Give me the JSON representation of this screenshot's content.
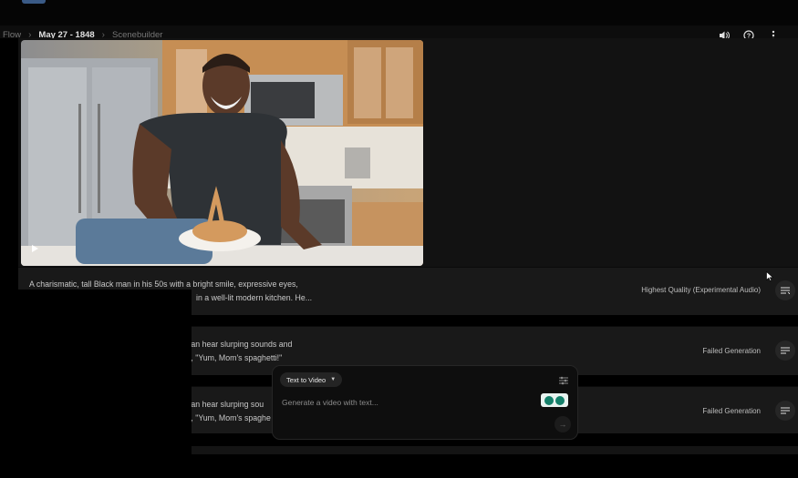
{
  "header": {
    "breadcrumb": [
      "Flow",
      "May 27 - 1848",
      "Scenebuilder"
    ],
    "icons": [
      "volume-icon",
      "help-icon",
      "more-vert-icon"
    ]
  },
  "video": {
    "play_icon": "play-icon"
  },
  "rows": [
    {
      "desc_line1": "A charismatic, tall Black man in his 50s with a bright smile, expressive eyes,",
      "desc_line2": "in a well-lit modern kitchen. He...",
      "status": "Highest Quality (Experimental Audio)"
    },
    {
      "desc_line1": "can hear slurping sounds and",
      "desc_line2": "s, \"Yum, Mom's spaghetti!\"",
      "status": "Failed Generation"
    },
    {
      "desc_line1": "can hear slurping sou",
      "desc_line2": "s, \"Yum, Mom's spaghe",
      "status": "Failed Generation"
    }
  ],
  "composer": {
    "mode_label": "Text to Video",
    "placeholder": "Generate a video with text...",
    "send_icon": "arrow-right-icon"
  },
  "colors": {
    "background": "#000000",
    "panel": "#191919",
    "accent": "#14806a"
  }
}
